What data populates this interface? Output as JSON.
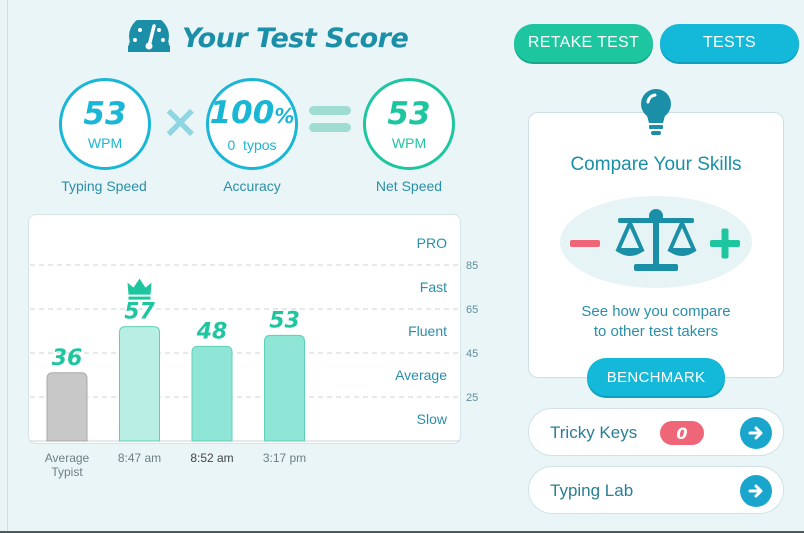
{
  "header": {
    "title": "Your Test Score"
  },
  "buttons": {
    "retake": "RETAKE TEST",
    "tests": "TESTS",
    "benchmark": "BENCHMARK"
  },
  "scores": {
    "typing_speed": {
      "value": "53",
      "unit": "WPM",
      "label": "Typing Speed"
    },
    "accuracy": {
      "value": "100",
      "percent": "%",
      "sub": "0  typos",
      "label": "Accuracy"
    },
    "net_speed": {
      "value": "53",
      "unit": "WPM",
      "label": "Net Speed"
    }
  },
  "compare": {
    "title": "Compare Your Skills",
    "desc_line1": "See how you compare",
    "desc_line2": "to other test takers"
  },
  "links": {
    "tricky_keys": {
      "label": "Tricky Keys",
      "count": "0"
    },
    "typing_lab": {
      "label": "Typing Lab"
    }
  },
  "colors": {
    "primary": "#1ab6d6",
    "green": "#1ec6a0",
    "title": "#1b8fa8",
    "badge": "#ee6677",
    "bar_grey": "#c8c8c8",
    "bar_green": "#8fe6d6"
  },
  "chart_data": {
    "type": "bar",
    "categories": [
      "Average Typist",
      "8:47 am",
      "8:52 am",
      "3:17 pm"
    ],
    "values": [
      36,
      57,
      48,
      53
    ],
    "best_marker_index": 1,
    "ylim": [
      5,
      105
    ],
    "y_ticks": [
      25,
      45,
      65,
      85
    ],
    "levels": [
      "Slow",
      "Average",
      "Fluent",
      "Fast",
      "PRO"
    ],
    "grid": true
  }
}
